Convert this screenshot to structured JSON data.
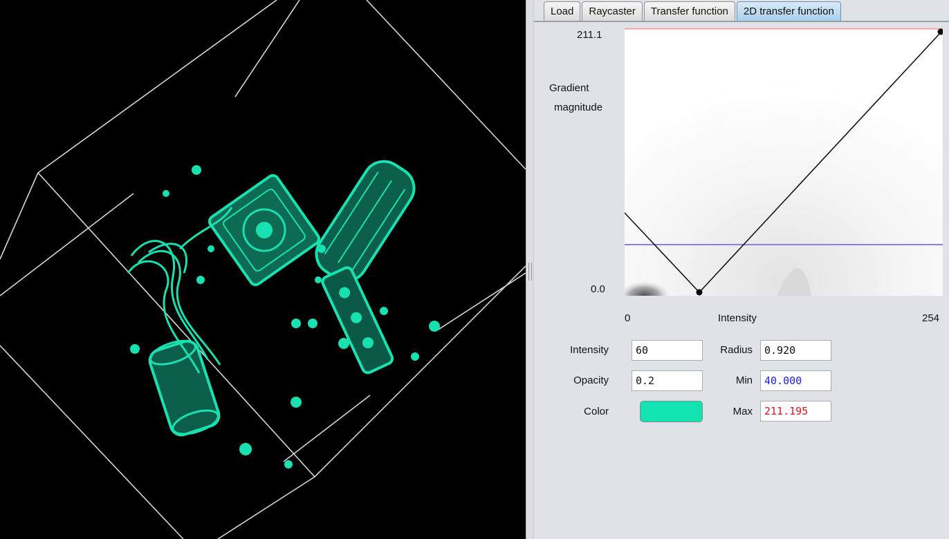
{
  "tabs": [
    {
      "label": "Load"
    },
    {
      "label": "Raycaster"
    },
    {
      "label": "Transfer function"
    },
    {
      "label": "2D transfer function",
      "active": true
    }
  ],
  "plot": {
    "y_max_label": "211.1",
    "y_min_label": "0.0",
    "y_axis_title_line1": "Gradient",
    "y_axis_title_line2": "magnitude",
    "x_min_label": "0",
    "x_axis_title": "Intensity",
    "x_max_label": "254"
  },
  "controls": {
    "intensity_label": "Intensity",
    "intensity_value": "60",
    "radius_label": "Radius",
    "radius_value": "0.920",
    "opacity_label": "Opacity",
    "opacity_value": "0.2",
    "min_label": "Min",
    "min_value": "40.000",
    "color_label": "Color",
    "max_label": "Max",
    "max_value": "211.195"
  },
  "colors": {
    "volume": "#19e0b0",
    "min_value_text": "#1e22d6",
    "max_value_text": "#e0141c",
    "min_line": "#8a7ee8",
    "max_line": "#ee9a9a",
    "swatch": "#13e3b1"
  },
  "icons": {
    "splitter_grip": "grip-icon",
    "control_point": "dot-icon"
  }
}
